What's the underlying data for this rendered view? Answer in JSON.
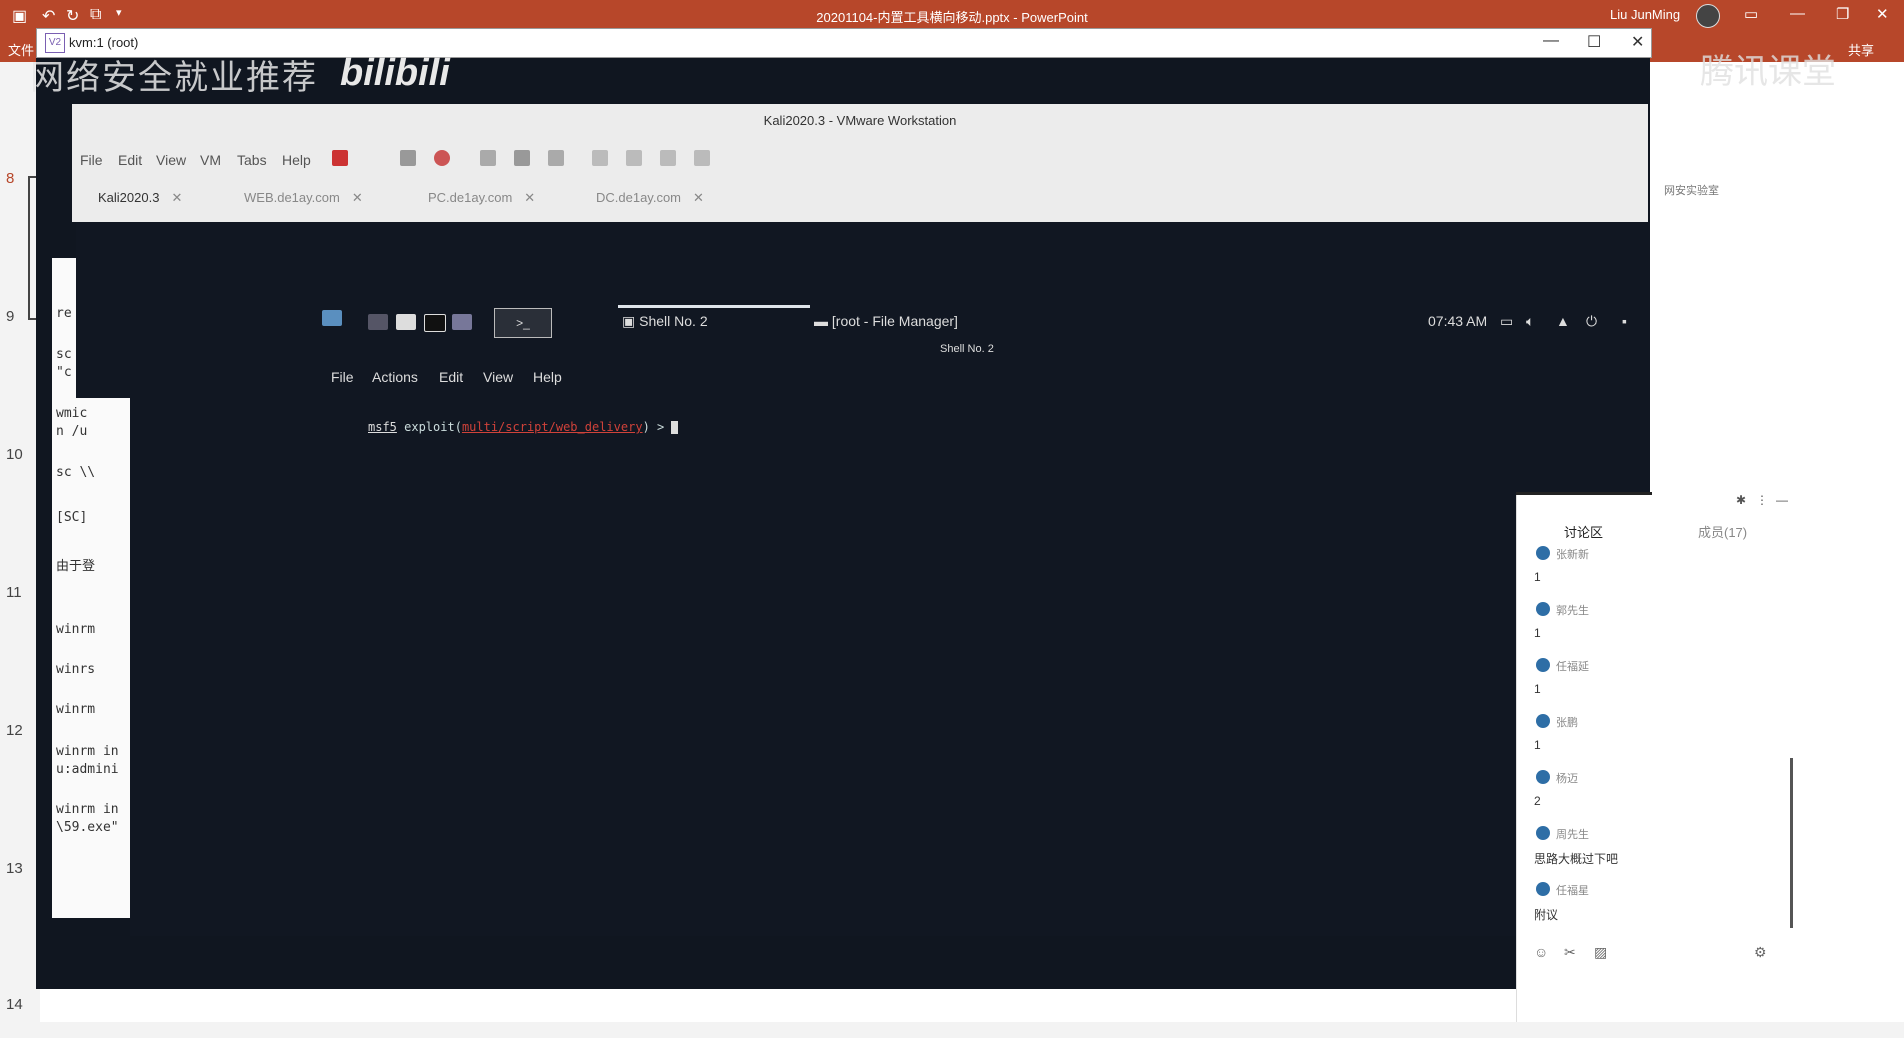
{
  "ppt": {
    "title": "20201104-内置工具横向移动.pptx  -  PowerPoint",
    "user": "Liu JunMing",
    "file_tab": "文件",
    "share": "共享",
    "slides": [
      "8",
      "9",
      "10",
      "11",
      "12",
      "13",
      "14"
    ]
  },
  "watermark": {
    "text": "网络安全就业推荐",
    "logo": "bilibili",
    "tencent": "腾讯课堂"
  },
  "kvm": {
    "title": "kvm:1 (root)"
  },
  "vmware": {
    "title": "Kali2020.3 - VMware Workstation",
    "menu": [
      "File",
      "Edit",
      "View",
      "VM",
      "Tabs",
      "Help"
    ],
    "tabs": [
      "Kali2020.3",
      "WEB.de1ay.com",
      "PC.de1ay.com",
      "DC.de1ay.com"
    ]
  },
  "kali": {
    "tasks": [
      "Shell No. 2",
      "[root - File Manager]"
    ],
    "clock": "07:43 AM",
    "term_window_title": "Shell No. 2",
    "term_menu": [
      "File",
      "Actions",
      "Edit",
      "View",
      "Help"
    ],
    "prompt": "msf5",
    "command_pre": " exploit(",
    "module": "multi/script/web_delivery",
    "command_post": ") > "
  },
  "slide_text": [
    "re",
    "sc",
    "\"c",
    "wmic",
    "n /u",
    "sc \\\\",
    "[SC]",
    "由于登",
    "winrm",
    "winrs",
    "winrm",
    "winrm in",
    "u:admini",
    "winrm in",
    "\\59.exe\""
  ],
  "chat": {
    "tab_active": "讨论区",
    "tab_members": "成员(17)",
    "messages": [
      {
        "name": "张新新",
        "text": "1"
      },
      {
        "name": "郭先生",
        "text": "1"
      },
      {
        "name": "任福延",
        "text": "1"
      },
      {
        "name": "张鹏",
        "text": "1"
      },
      {
        "name": "杨迈",
        "text": "2"
      },
      {
        "name": "周先生",
        "text": "思路大概过下吧"
      },
      {
        "name": "任福星",
        "text": "附议"
      }
    ]
  },
  "side_label": "网安实验室"
}
